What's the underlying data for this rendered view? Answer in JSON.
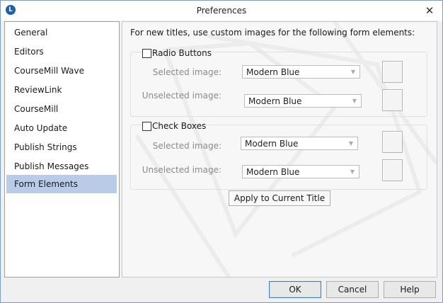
{
  "window": {
    "title": "Preferences",
    "app_icon_glyph": "L",
    "close_glyph": "✕"
  },
  "sidebar": {
    "items": [
      {
        "label": "General"
      },
      {
        "label": "Editors"
      },
      {
        "label": "CourseMill Wave"
      },
      {
        "label": "ReviewLink"
      },
      {
        "label": "CourseMill"
      },
      {
        "label": "Auto Update"
      },
      {
        "label": "Publish Strings"
      },
      {
        "label": "Publish Messages"
      },
      {
        "label": "Form Elements",
        "selected": true
      }
    ]
  },
  "main": {
    "intro": "For new titles, use custom images for the following form elements:",
    "radio_group": {
      "label": "Radio Buttons",
      "checked": false,
      "selected_label": "Selected image:",
      "selected_value": "Modern Blue",
      "unselected_label": "Unselected image:",
      "unselected_value": "Modern Blue"
    },
    "check_group": {
      "label": "Check Boxes",
      "checked": false,
      "selected_label": "Selected image:",
      "selected_value": "Modern Blue",
      "unselected_label": "Unselected image:",
      "unselected_value": "Modern Blue"
    },
    "apply_label": "Apply to Current Title"
  },
  "footer": {
    "ok_label": "OK",
    "cancel_label": "Cancel",
    "help_label": "Help"
  },
  "colors": {
    "selection": "#b9cbe6",
    "window_border": "#7a9cc8",
    "default_button_border": "#3c7fc7"
  }
}
